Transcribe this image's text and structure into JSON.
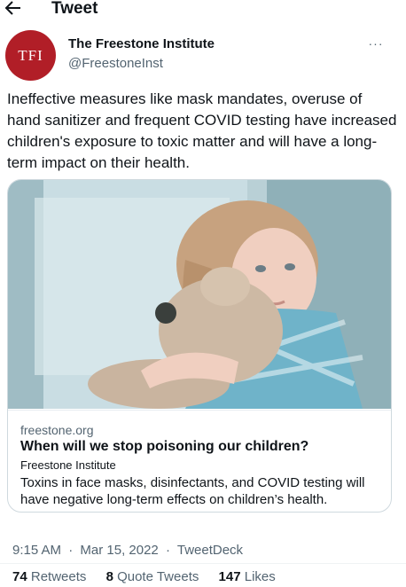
{
  "header": {
    "title": "Tweet",
    "back_icon": "arrow-left-icon"
  },
  "author": {
    "avatar_text": "TFI",
    "avatar_color": "#b11e27",
    "display_name": "The Freestone Institute",
    "handle": "@FreestoneInst"
  },
  "more_icon": "more-horizontal-icon",
  "more_label": "···",
  "tweet": {
    "text": "Ineffective measures like mask mandates, overuse of hand sanitizer and frequent COVID testing have increased children's exposure to toxic matter and will have a long-term impact on their health."
  },
  "card": {
    "image_description": "",
    "domain": "freestone.org",
    "title": "When will we stop poisoning our children?",
    "site": "Freestone Institute",
    "description": "Toxins in face masks, disinfectants, and COVID testing will have negative long-term effects on children’s health."
  },
  "meta": {
    "time": "9:15 AM",
    "date": "Mar 15, 2022",
    "source": "TweetDeck"
  },
  "stats": {
    "retweets_count": "74",
    "retweets_label": "Retweets",
    "quotes_count": "8",
    "quotes_label": "Quote Tweets",
    "likes_count": "147",
    "likes_label": "Likes"
  }
}
